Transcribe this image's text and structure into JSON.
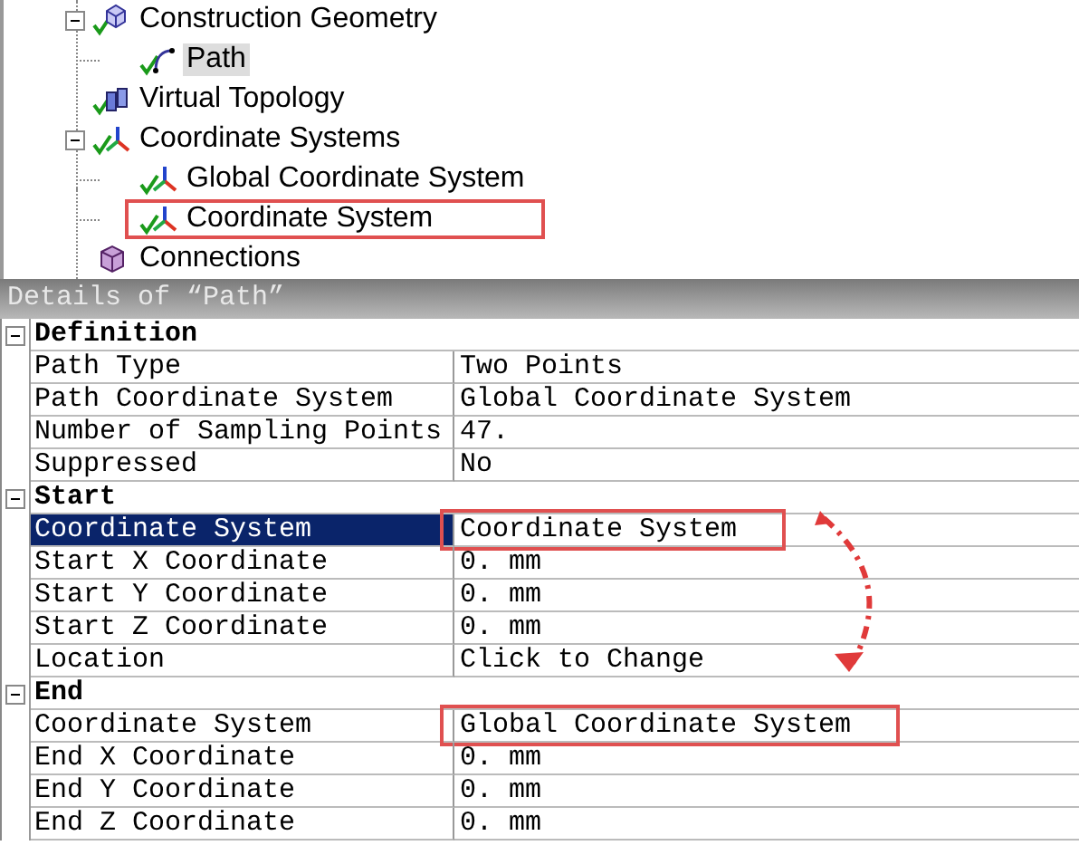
{
  "tree": [
    {
      "label": "Construction Geometry",
      "kind": "geometry",
      "expanded": true,
      "selected": false,
      "highlighted": false,
      "children": [
        {
          "label": "Path",
          "kind": "path",
          "selected": true,
          "highlighted": false
        }
      ]
    },
    {
      "label": "Virtual Topology",
      "kind": "topology",
      "selected": false,
      "highlighted": false
    },
    {
      "label": "Coordinate Systems",
      "kind": "axes",
      "expanded": true,
      "selected": false,
      "highlighted": false,
      "children": [
        {
          "label": "Global Coordinate System",
          "kind": "axes",
          "selected": false,
          "highlighted": false
        },
        {
          "label": "Coordinate System",
          "kind": "axes",
          "selected": false,
          "highlighted": true
        }
      ]
    },
    {
      "label": "Connections",
      "kind": "connections",
      "selected": false,
      "highlighted": false
    }
  ],
  "details": {
    "title": "Details of “Path”",
    "sections": [
      {
        "label": "Definition",
        "expanded": true,
        "rows": [
          {
            "label": "Path Type",
            "value": "Two Points",
            "selected": false,
            "highlighted": false
          },
          {
            "label": "Path Coordinate System",
            "value": "Global Coordinate System",
            "selected": false,
            "highlighted": false
          },
          {
            "label": "Number of Sampling Points",
            "value": "47.",
            "selected": false,
            "highlighted": false
          },
          {
            "label": "Suppressed",
            "value": "No",
            "selected": false,
            "highlighted": false
          }
        ]
      },
      {
        "label": "Start",
        "expanded": true,
        "rows": [
          {
            "label": "Coordinate System",
            "value": "Coordinate System",
            "selected": true,
            "highlighted": true
          },
          {
            "label": "Start X Coordinate",
            "value": "0. mm",
            "selected": false,
            "highlighted": false
          },
          {
            "label": "Start Y Coordinate",
            "value": "0. mm",
            "selected": false,
            "highlighted": false
          },
          {
            "label": "Start Z Coordinate",
            "value": "0. mm",
            "selected": false,
            "highlighted": false
          },
          {
            "label": "Location",
            "value": "Click to Change",
            "selected": false,
            "highlighted": false
          }
        ]
      },
      {
        "label": "End",
        "expanded": true,
        "rows": [
          {
            "label": "Coordinate System",
            "value": "Global Coordinate System",
            "selected": false,
            "highlighted": true
          },
          {
            "label": "End X Coordinate",
            "value": "0. mm",
            "selected": false,
            "highlighted": false
          },
          {
            "label": "End Y Coordinate",
            "value": "0. mm",
            "selected": false,
            "highlighted": false
          },
          {
            "label": "End Z Coordinate",
            "value": "0. mm",
            "selected": false,
            "highlighted": false
          }
        ]
      }
    ]
  }
}
